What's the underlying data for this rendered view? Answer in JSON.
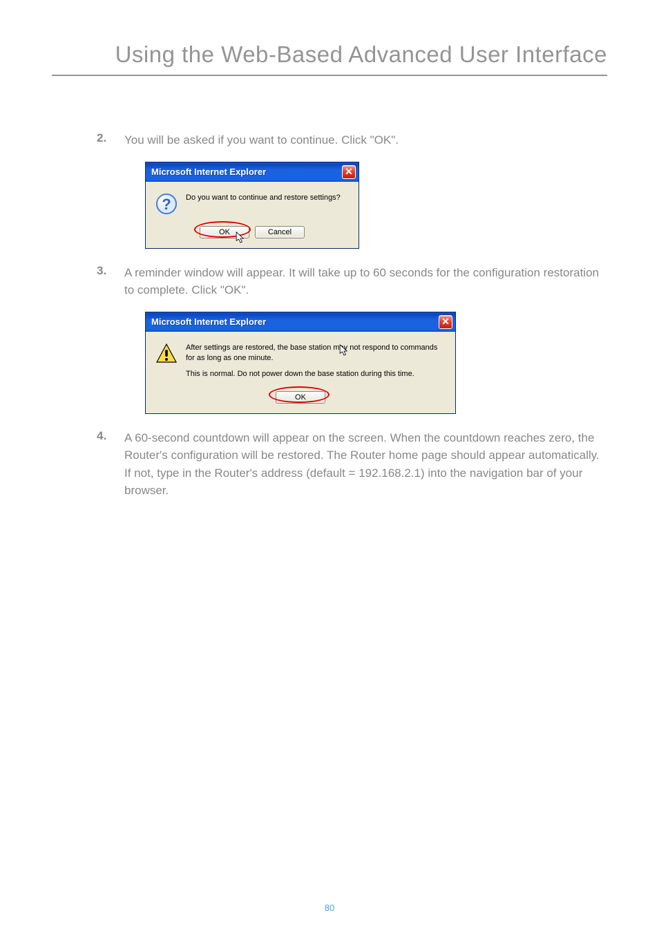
{
  "page": {
    "title": "Using the Web-Based Advanced User Interface",
    "number": "80"
  },
  "steps": {
    "s2": {
      "num": "2.",
      "text": "You will be asked if you want to continue. Click \"OK\"."
    },
    "s3": {
      "num": "3.",
      "text": "A reminder window will appear. It will take up to 60 seconds for the configuration restoration to complete. Click \"OK\"."
    },
    "s4": {
      "num": "4.",
      "text": "A 60-second countdown will appear on the screen. When the countdown reaches zero, the Router's configuration will be restored. The Router home page should appear automatically. If not, type in the Router's address (default = 192.168.2.1) into the navigation bar of your browser."
    }
  },
  "dialog1": {
    "title": "Microsoft Internet Explorer",
    "message": "Do you want to continue and restore settings?",
    "ok": "OK",
    "cancel": "Cancel",
    "close": "✕"
  },
  "dialog2": {
    "title": "Microsoft Internet Explorer",
    "line1": "After settings are restored, the base station may not respond to commands for as long as one minute.",
    "line2": "This is normal. Do not power down the base station during this time.",
    "ok": "OK",
    "close": "✕"
  }
}
